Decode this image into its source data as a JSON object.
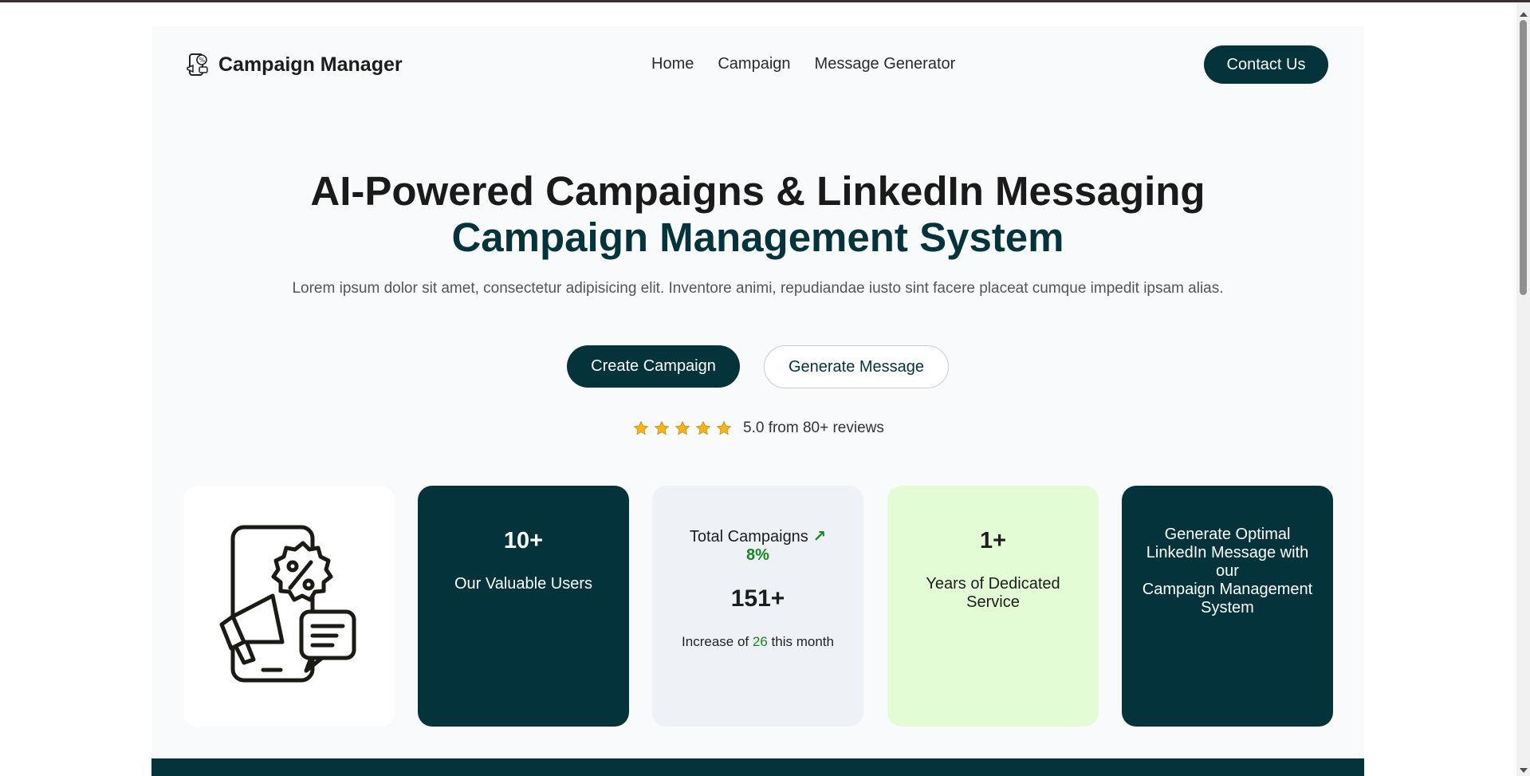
{
  "navbar": {
    "brand": "Campaign Manager",
    "links": [
      "Home",
      "Campaign",
      "Message Generator"
    ],
    "contact_label": "Contact Us"
  },
  "hero": {
    "title": "AI-Powered Campaigns & LinkedIn Messaging",
    "subtitle": "Campaign Management System",
    "description": "Lorem ipsum dolor sit amet, consectetur adipisicing elit. Inventore animi, repudiandae iusto sint facere placeat cumque impedit ipsam alias.",
    "primary_button": "Create Campaign",
    "secondary_button": "Generate Message"
  },
  "rating": {
    "stars": 5,
    "text": "5.0 from 80+ reviews"
  },
  "cards": {
    "users": {
      "value": "10+",
      "label": "Our Valuable Users"
    },
    "campaigns": {
      "title": "Total Campaigns",
      "trend_icon": "↗",
      "percent": "8%",
      "value": "151+",
      "footer_prefix": "Increase of",
      "footer_count": "26",
      "footer_suffix": "this month"
    },
    "years": {
      "value": "1+",
      "label": "Years of Dedicated Service"
    },
    "generate": {
      "line1": "Generate Optimal LinkedIn Message with our",
      "line2": "Campaign Management System"
    }
  },
  "icons": {
    "brand": "campaign-logo-icon",
    "illustration": "phone-megaphone-discount-icon",
    "star": "star-icon",
    "trend": "trend-up-arrow-icon"
  },
  "colors": {
    "primary": "#04333b",
    "accent_green": "#138a1b",
    "card_light_green": "#e3fcd6",
    "card_light_gray": "#eef2f6",
    "star": "#f4b41a"
  }
}
